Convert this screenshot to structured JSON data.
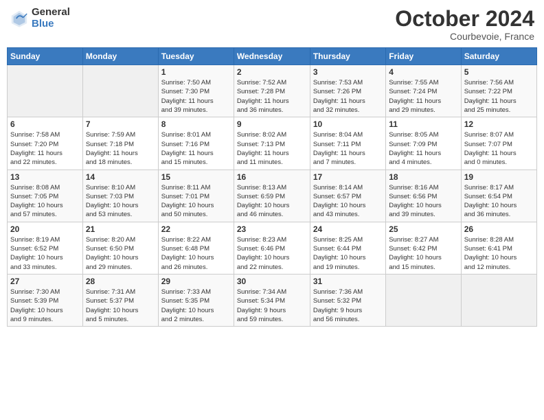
{
  "header": {
    "logo_general": "General",
    "logo_blue": "Blue",
    "month_title": "October 2024",
    "location": "Courbevoie, France"
  },
  "weekdays": [
    "Sunday",
    "Monday",
    "Tuesday",
    "Wednesday",
    "Thursday",
    "Friday",
    "Saturday"
  ],
  "weeks": [
    [
      {
        "day": "",
        "detail": ""
      },
      {
        "day": "",
        "detail": ""
      },
      {
        "day": "1",
        "detail": "Sunrise: 7:50 AM\nSunset: 7:30 PM\nDaylight: 11 hours\nand 39 minutes."
      },
      {
        "day": "2",
        "detail": "Sunrise: 7:52 AM\nSunset: 7:28 PM\nDaylight: 11 hours\nand 36 minutes."
      },
      {
        "day": "3",
        "detail": "Sunrise: 7:53 AM\nSunset: 7:26 PM\nDaylight: 11 hours\nand 32 minutes."
      },
      {
        "day": "4",
        "detail": "Sunrise: 7:55 AM\nSunset: 7:24 PM\nDaylight: 11 hours\nand 29 minutes."
      },
      {
        "day": "5",
        "detail": "Sunrise: 7:56 AM\nSunset: 7:22 PM\nDaylight: 11 hours\nand 25 minutes."
      }
    ],
    [
      {
        "day": "6",
        "detail": "Sunrise: 7:58 AM\nSunset: 7:20 PM\nDaylight: 11 hours\nand 22 minutes."
      },
      {
        "day": "7",
        "detail": "Sunrise: 7:59 AM\nSunset: 7:18 PM\nDaylight: 11 hours\nand 18 minutes."
      },
      {
        "day": "8",
        "detail": "Sunrise: 8:01 AM\nSunset: 7:16 PM\nDaylight: 11 hours\nand 15 minutes."
      },
      {
        "day": "9",
        "detail": "Sunrise: 8:02 AM\nSunset: 7:13 PM\nDaylight: 11 hours\nand 11 minutes."
      },
      {
        "day": "10",
        "detail": "Sunrise: 8:04 AM\nSunset: 7:11 PM\nDaylight: 11 hours\nand 7 minutes."
      },
      {
        "day": "11",
        "detail": "Sunrise: 8:05 AM\nSunset: 7:09 PM\nDaylight: 11 hours\nand 4 minutes."
      },
      {
        "day": "12",
        "detail": "Sunrise: 8:07 AM\nSunset: 7:07 PM\nDaylight: 11 hours\nand 0 minutes."
      }
    ],
    [
      {
        "day": "13",
        "detail": "Sunrise: 8:08 AM\nSunset: 7:05 PM\nDaylight: 10 hours\nand 57 minutes."
      },
      {
        "day": "14",
        "detail": "Sunrise: 8:10 AM\nSunset: 7:03 PM\nDaylight: 10 hours\nand 53 minutes."
      },
      {
        "day": "15",
        "detail": "Sunrise: 8:11 AM\nSunset: 7:01 PM\nDaylight: 10 hours\nand 50 minutes."
      },
      {
        "day": "16",
        "detail": "Sunrise: 8:13 AM\nSunset: 6:59 PM\nDaylight: 10 hours\nand 46 minutes."
      },
      {
        "day": "17",
        "detail": "Sunrise: 8:14 AM\nSunset: 6:57 PM\nDaylight: 10 hours\nand 43 minutes."
      },
      {
        "day": "18",
        "detail": "Sunrise: 8:16 AM\nSunset: 6:56 PM\nDaylight: 10 hours\nand 39 minutes."
      },
      {
        "day": "19",
        "detail": "Sunrise: 8:17 AM\nSunset: 6:54 PM\nDaylight: 10 hours\nand 36 minutes."
      }
    ],
    [
      {
        "day": "20",
        "detail": "Sunrise: 8:19 AM\nSunset: 6:52 PM\nDaylight: 10 hours\nand 33 minutes."
      },
      {
        "day": "21",
        "detail": "Sunrise: 8:20 AM\nSunset: 6:50 PM\nDaylight: 10 hours\nand 29 minutes."
      },
      {
        "day": "22",
        "detail": "Sunrise: 8:22 AM\nSunset: 6:48 PM\nDaylight: 10 hours\nand 26 minutes."
      },
      {
        "day": "23",
        "detail": "Sunrise: 8:23 AM\nSunset: 6:46 PM\nDaylight: 10 hours\nand 22 minutes."
      },
      {
        "day": "24",
        "detail": "Sunrise: 8:25 AM\nSunset: 6:44 PM\nDaylight: 10 hours\nand 19 minutes."
      },
      {
        "day": "25",
        "detail": "Sunrise: 8:27 AM\nSunset: 6:42 PM\nDaylight: 10 hours\nand 15 minutes."
      },
      {
        "day": "26",
        "detail": "Sunrise: 8:28 AM\nSunset: 6:41 PM\nDaylight: 10 hours\nand 12 minutes."
      }
    ],
    [
      {
        "day": "27",
        "detail": "Sunrise: 7:30 AM\nSunset: 5:39 PM\nDaylight: 10 hours\nand 9 minutes."
      },
      {
        "day": "28",
        "detail": "Sunrise: 7:31 AM\nSunset: 5:37 PM\nDaylight: 10 hours\nand 5 minutes."
      },
      {
        "day": "29",
        "detail": "Sunrise: 7:33 AM\nSunset: 5:35 PM\nDaylight: 10 hours\nand 2 minutes."
      },
      {
        "day": "30",
        "detail": "Sunrise: 7:34 AM\nSunset: 5:34 PM\nDaylight: 9 hours\nand 59 minutes."
      },
      {
        "day": "31",
        "detail": "Sunrise: 7:36 AM\nSunset: 5:32 PM\nDaylight: 9 hours\nand 56 minutes."
      },
      {
        "day": "",
        "detail": ""
      },
      {
        "day": "",
        "detail": ""
      }
    ]
  ]
}
